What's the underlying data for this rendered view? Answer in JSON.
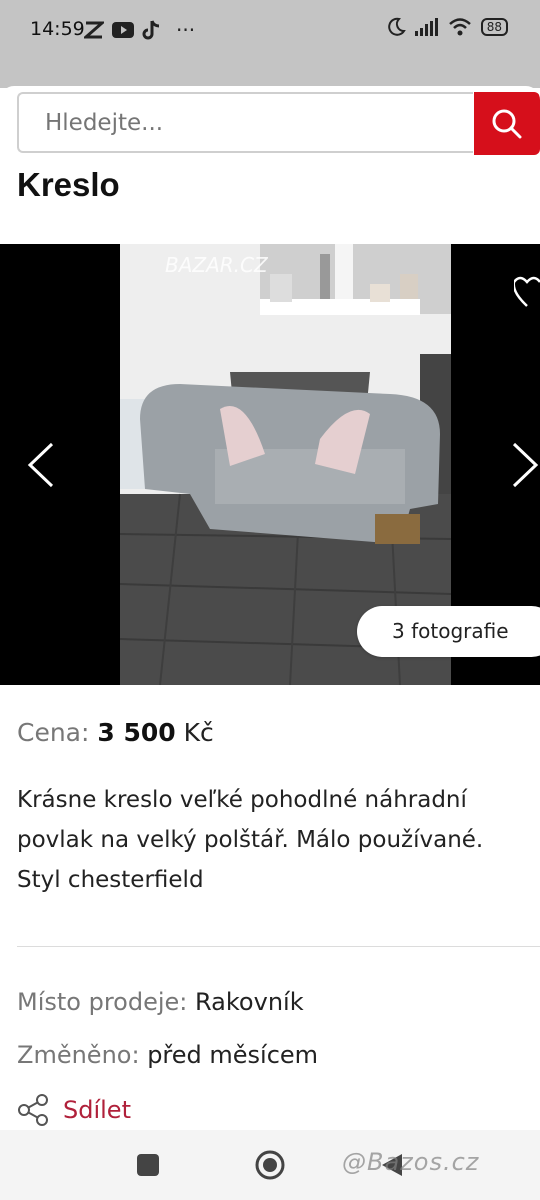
{
  "status_bar": {
    "time": "14:59",
    "battery": "88"
  },
  "search": {
    "placeholder": "Hledejte..."
  },
  "listing": {
    "title": "Kreslo",
    "photo_watermark": "BAZAR.CZ",
    "photo_count_label": "3 fotografie",
    "price_label": "Cena:",
    "price_value": "3 500",
    "price_currency": "Kč",
    "description": "Krásne kreslo veľké pohodlné náhradní povlak na velký polštář. Málo používané. Styl chesterfield",
    "location_label": "Místo prodeje:",
    "location_value": "Rakovník",
    "changed_label": "Změněno:",
    "changed_value": "před měsícem",
    "share_label": "Sdílet"
  },
  "watermark": "@Bazos.cz",
  "colors": {
    "accent_red": "#d60f1b",
    "share_red": "#b0203a"
  }
}
